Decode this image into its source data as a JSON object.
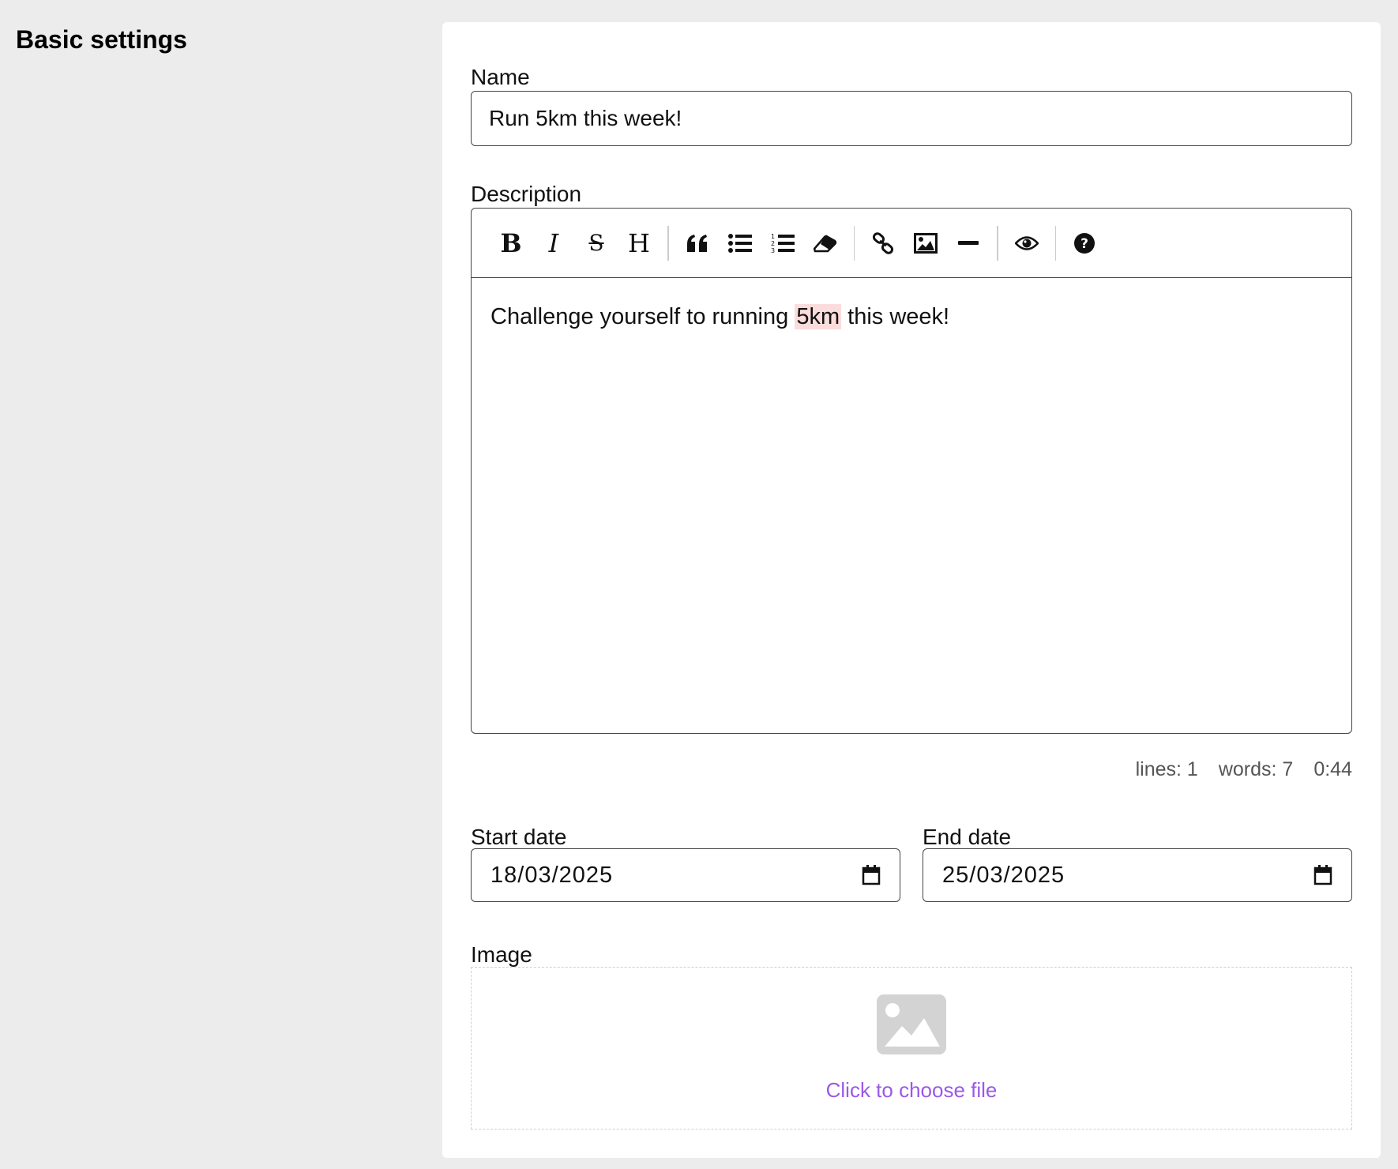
{
  "section": {
    "title": "Basic settings"
  },
  "name_field": {
    "label": "Name",
    "value": "Run 5km this week!"
  },
  "description_field": {
    "label": "Description",
    "toolbar": {
      "groups": [
        [
          "bold-icon",
          "italic-icon",
          "strikethrough-icon",
          "heading-icon"
        ],
        [
          "quote-icon",
          "unordered-list-icon",
          "ordered-list-icon",
          "eraser-icon"
        ],
        [
          "link-icon",
          "image-icon",
          "horizontal-rule-icon"
        ],
        [
          "preview-eye-icon"
        ],
        [
          "help-icon"
        ]
      ]
    },
    "content": {
      "before": "Challenge yourself to running ",
      "highlight": "5km",
      "after": " this week!"
    },
    "status": {
      "lines": "lines: 1",
      "words": "words: 7",
      "cursor": "0:44"
    }
  },
  "start_date": {
    "label": "Start date",
    "value": "18/03/2025"
  },
  "end_date": {
    "label": "End date",
    "value": "25/03/2025"
  },
  "image_field": {
    "label": "Image",
    "prompt": "Click to choose file",
    "link_color": "#9b59e6",
    "icon": "image-placeholder-icon"
  },
  "colors": {
    "page_background": "#ececec",
    "card_background": "#ffffff",
    "highlight": "#fbdcdc"
  }
}
